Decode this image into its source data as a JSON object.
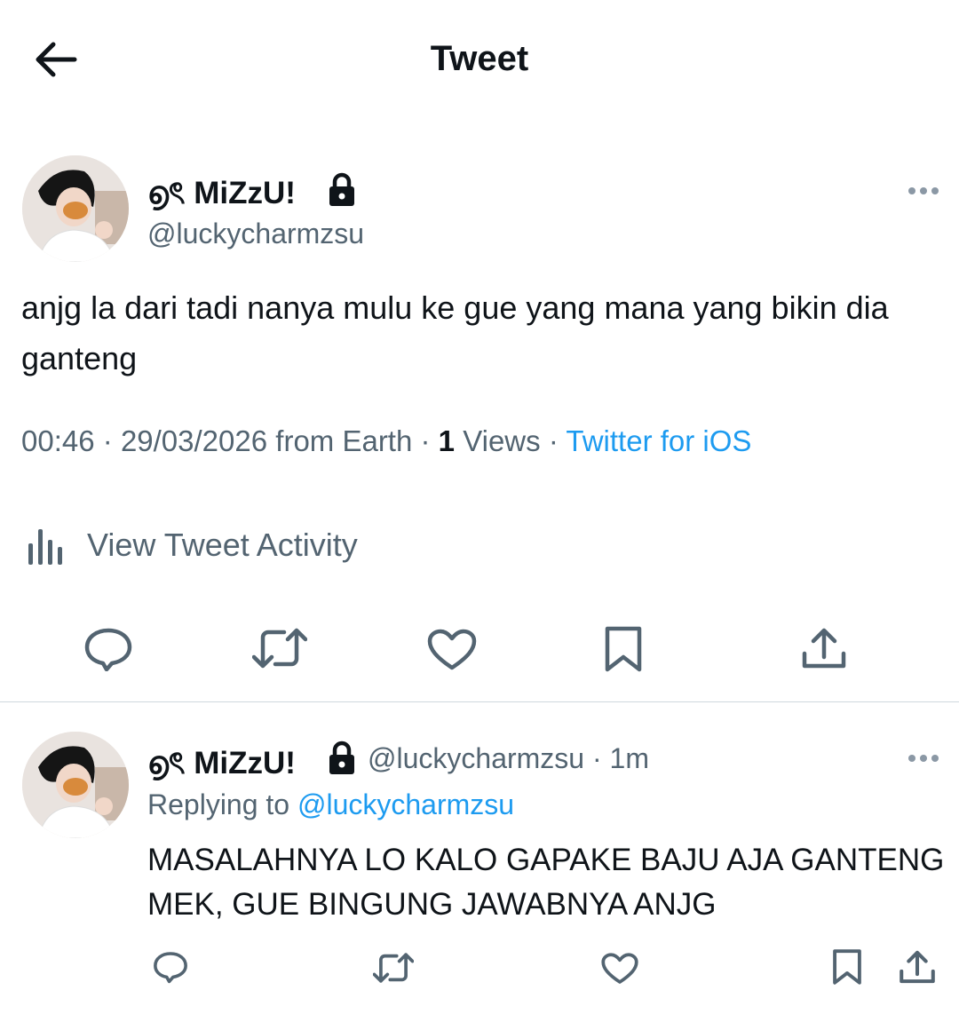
{
  "header": {
    "title": "Tweet",
    "back_icon": "arrow-left-icon"
  },
  "tweet": {
    "name": "൭ৎ MiZzU!",
    "handle": "@luckycharmzsu",
    "protected_icon": "lock-icon",
    "text": "anjg la dari tadi nanya mulu ke gue yang mana yang bikin dia ganteng",
    "time": "00:46",
    "date": "29/03/2026",
    "location": "from Earth",
    "views_count": "1",
    "views_label": "Views",
    "source": "Twitter for iOS",
    "separator": "·",
    "activity_label": "View Tweet Activity",
    "actions": [
      "reply-icon",
      "retweet-icon",
      "like-icon",
      "bookmark-icon",
      "share-icon"
    ]
  },
  "reply": {
    "name": "൭ৎ MiZzU!",
    "handle": "@luckycharmzsu",
    "time": "· 1m",
    "replying_label": "Replying to",
    "replying_handle": "@luckycharmzsu",
    "text": "MASALAHNYA LO KALO GAPAKE BAJU AJA GANTENG MEK, GUE BINGUNG JAWABNYA ANJG"
  },
  "colors": {
    "link": "#1d9bf0",
    "muted": "#536471",
    "text": "#0f1419",
    "divider": "#cfd9de"
  }
}
